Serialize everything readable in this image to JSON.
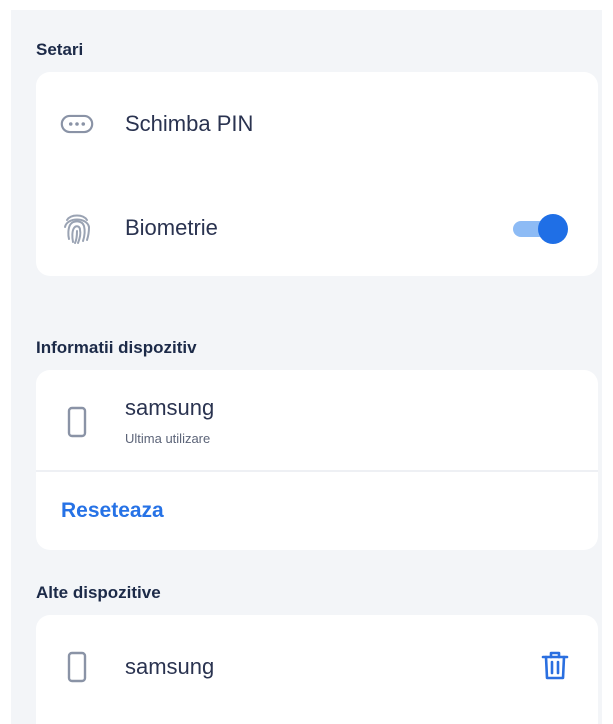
{
  "settings": {
    "title": "Setari",
    "items": [
      {
        "label": "Schimba PIN",
        "icon": "pin-dots-icon"
      },
      {
        "label": "Biometrie",
        "icon": "fingerprint-icon",
        "toggle_on": true
      }
    ]
  },
  "device_info": {
    "title": "Informatii dispozitiv",
    "device_name": "samsung",
    "last_used_label": "Ultima utilizare",
    "reset_label": "Reseteaza"
  },
  "other_devices": {
    "title": "Alte dispozitive",
    "items": [
      {
        "name": "samsung",
        "icon": "phone-icon",
        "action_icon": "trash-icon"
      }
    ]
  },
  "colors": {
    "accent": "#2672e6",
    "toggle_track": "#8dbbf5",
    "toggle_knob": "#1f6fe6",
    "background": "#f3f5f8",
    "card": "#ffffff"
  }
}
